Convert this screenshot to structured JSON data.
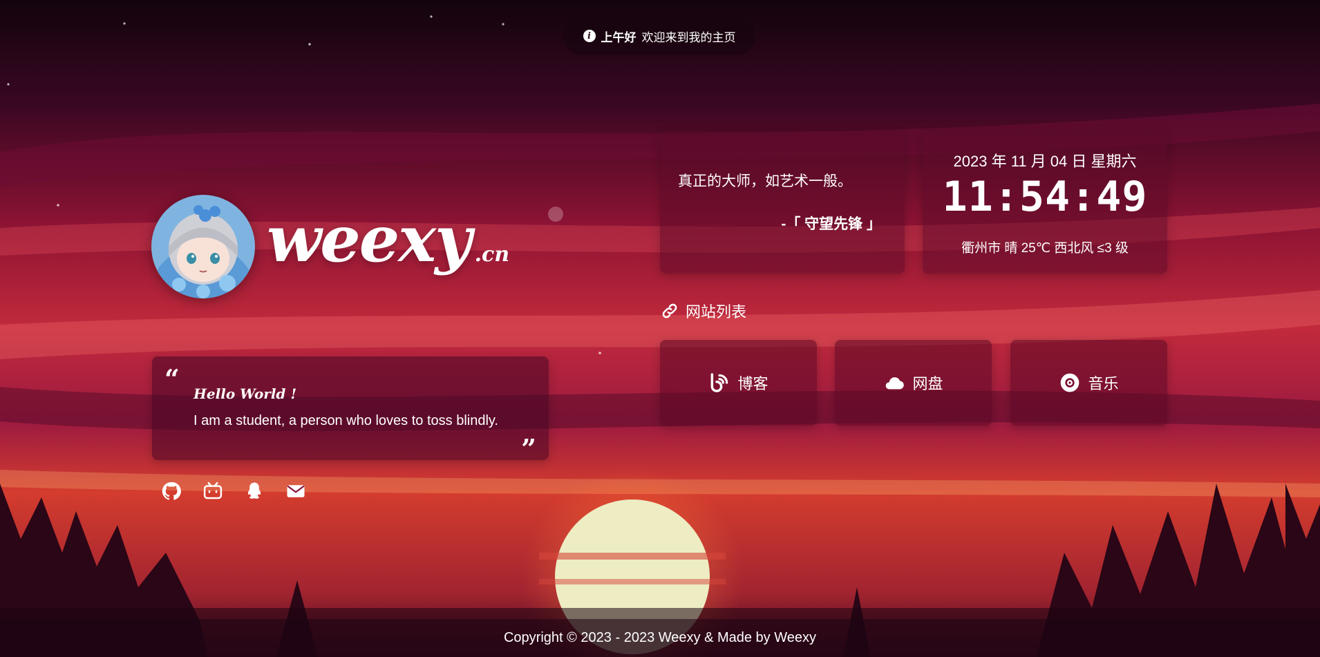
{
  "greeting": {
    "icon": "info-icon",
    "hello": "上午好",
    "message": "欢迎来到我的主页"
  },
  "brand": {
    "name": "weexy",
    "tld": ".cn"
  },
  "intro": {
    "title": "Hello World !",
    "text": "I am a student, a person who loves to toss blindly."
  },
  "socials": [
    {
      "name": "github",
      "icon": "github-icon"
    },
    {
      "name": "bilibili",
      "icon": "bilibili-icon"
    },
    {
      "name": "qq",
      "icon": "qq-icon"
    },
    {
      "name": "email",
      "icon": "mail-icon"
    }
  ],
  "hitokoto": {
    "text": "真正的大师，如艺术一般。",
    "from": "-「 守望先锋 」"
  },
  "clock": {
    "date": "2023 年 11 月 04 日 星期六",
    "time": "11:54:49",
    "weather": "衢州市 晴 25℃  西北风  ≤3 级"
  },
  "sites": {
    "heading": "网站列表",
    "items": [
      {
        "label": "博客",
        "icon": "blog-icon"
      },
      {
        "label": "网盘",
        "icon": "cloud-icon"
      },
      {
        "label": "音乐",
        "icon": "music-disc-icon"
      }
    ]
  },
  "footer": {
    "text": "Copyright © 2023 - 2023 Weexy & Made by Weexy"
  },
  "colors": {
    "sky_top": "#12040c",
    "sky_mid": "#b41d3a",
    "sun": "#f2efc4",
    "card": "#5a0a28"
  }
}
